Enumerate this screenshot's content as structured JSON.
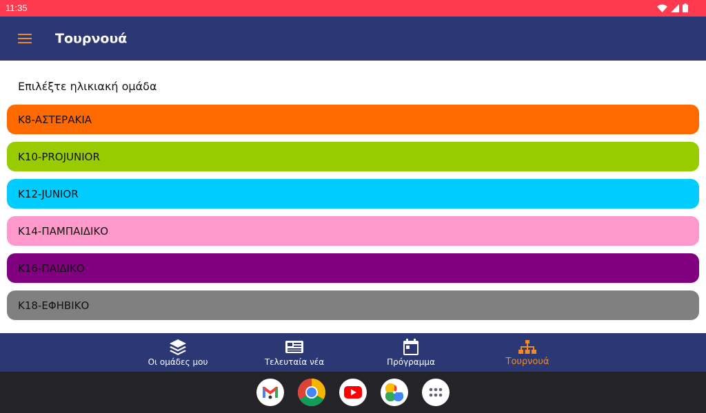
{
  "status_bar": {
    "time": "11:35",
    "icons": [
      "wifi-icon",
      "signal-icon",
      "battery-icon"
    ],
    "color": "#fd3a4f"
  },
  "app_bar": {
    "title": "Τουρνουά",
    "menu_icon": "hamburger-menu-icon",
    "color": "#2c3874",
    "icon_color": "#f08a2a"
  },
  "content": {
    "subtitle": "Επιλέξτε ηλικιακή ομάδα",
    "groups": [
      {
        "label": "Κ8-ΑΣΤΕΡΑΚΙΑ",
        "color": "#ff6a00"
      },
      {
        "label": "Κ10-PROJUNIOR",
        "color": "#99cc00"
      },
      {
        "label": "Κ12-JUNIOR",
        "color": "#00ccff"
      },
      {
        "label": "Κ14-ΠΑΜΠΑΙΔΙΚΟ",
        "color": "#ff99cc"
      },
      {
        "label": "Κ16-ΠΑΙΔΙΚΟ",
        "color": "#800080"
      },
      {
        "label": "Κ18-ΕΦΗΒΙΚΟ",
        "color": "#808080"
      }
    ]
  },
  "bottom_nav": {
    "items": [
      {
        "label": "Οι ομάδες μου",
        "icon": "layers-icon",
        "active": false
      },
      {
        "label": "Τελευταία νέα",
        "icon": "newspaper-icon",
        "active": false
      },
      {
        "label": "Πρόγραμμα",
        "icon": "calendar-icon",
        "active": false
      },
      {
        "label": "Τουρνουά",
        "icon": "tournament-tree-icon",
        "active": true
      }
    ],
    "active_color": "#f08a2a"
  },
  "dock": {
    "apps": [
      "gmail-icon",
      "chrome-icon",
      "youtube-icon",
      "photos-icon",
      "app-drawer-icon"
    ]
  }
}
